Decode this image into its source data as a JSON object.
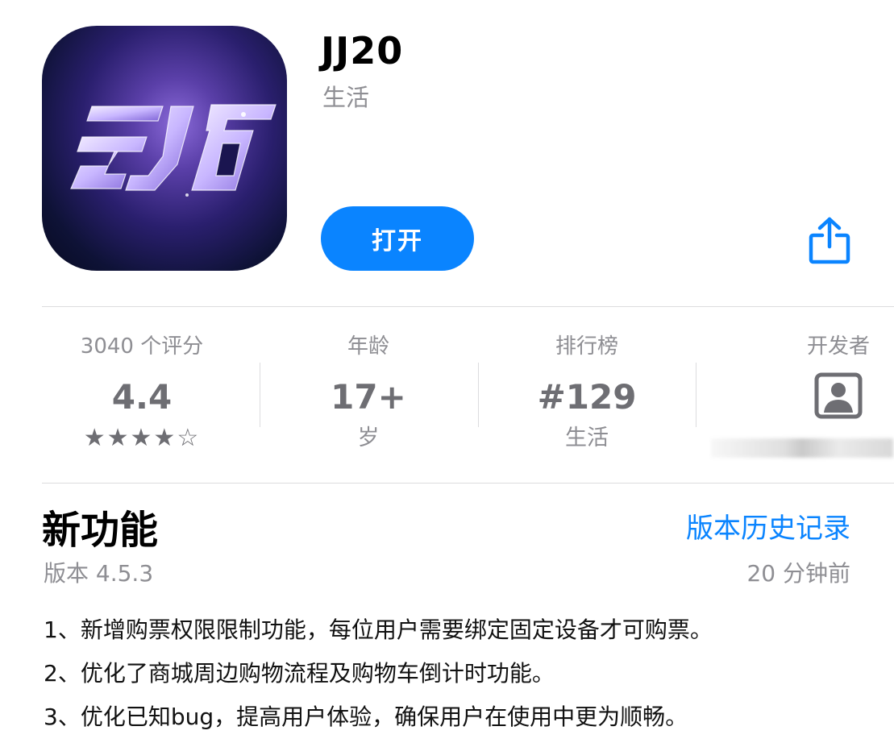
{
  "app": {
    "name": "JJ20",
    "category": "生活",
    "open_label": "打开",
    "icon_name": "jj20-app-logo-icon"
  },
  "stats": {
    "ratings": {
      "label": "3040 个评分",
      "value": "4.4",
      "stars_rating": 4.4,
      "stars_text": "★★★★☆"
    },
    "age": {
      "label": "年龄",
      "value": "17+",
      "sub": "岁"
    },
    "chart": {
      "label": "排行榜",
      "value": "#129",
      "sub": "生活"
    },
    "developer": {
      "label": "开发者",
      "icon": "developer-avatar-icon"
    }
  },
  "whats_new": {
    "title": "新功能",
    "history_link": "版本历史记录",
    "version": "版本 4.5.3",
    "time_ago": "20 分钟前",
    "notes": [
      "1、新增购票权限限制功能，每位用户需要绑定固定设备才可购票。",
      "2、优化了商城周边购物流程及购物车倒计时功能。",
      "3、优化已知bug，提高用户体验，确保用户在使用中更为顺畅。"
    ]
  },
  "colors": {
    "accent": "#0a84ff",
    "secondary_text": "#8e8e93",
    "stat_value": "#6e6e73",
    "divider": "#dcdcde"
  }
}
